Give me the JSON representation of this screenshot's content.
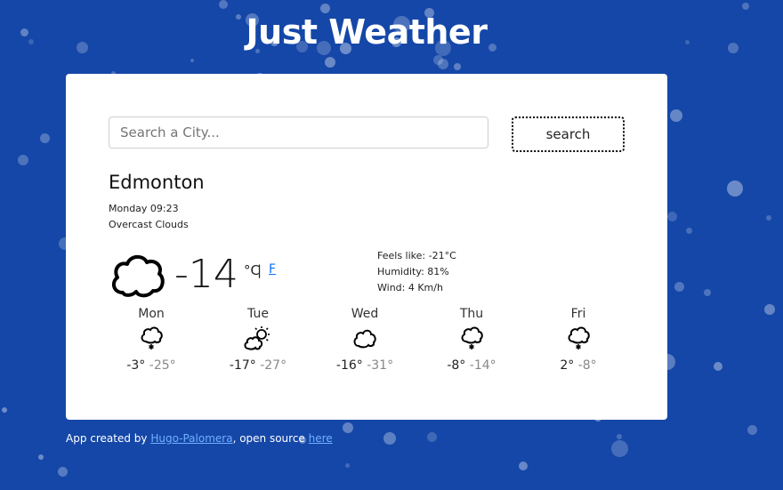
{
  "app": {
    "title": "Just Weather"
  },
  "search": {
    "placeholder": "Search a City...",
    "button_label": "search"
  },
  "current": {
    "city": "Edmonton",
    "datetime": "Monday 09:23",
    "description": "Overcast Clouds",
    "icon": "cloud-icon",
    "temperature": "-14",
    "unit_celsius": "°C",
    "unit_separator": "|",
    "unit_fahrenheit": "F",
    "feels_like": "Feels like: -21°C",
    "humidity": "Humidity: 81%",
    "wind": "Wind: 4 Km/h"
  },
  "forecast": [
    {
      "day": "Mon",
      "icon": "cloud-snow-icon",
      "max": "-3°",
      "min": "-25°"
    },
    {
      "day": "Tue",
      "icon": "sun-cloud-icon",
      "max": "-17°",
      "min": "-27°"
    },
    {
      "day": "Wed",
      "icon": "cloud-icon",
      "max": "-16°",
      "min": "-31°"
    },
    {
      "day": "Thu",
      "icon": "cloud-snow-icon",
      "max": "-8°",
      "min": "-14°"
    },
    {
      "day": "Fri",
      "icon": "cloud-snow-icon",
      "max": "2°",
      "min": "-8°"
    }
  ],
  "footer": {
    "prefix": "App created by ",
    "author": "Hugo-Palomera",
    "middle": ", open source ",
    "link": "here"
  },
  "colors": {
    "background": "#1547a8",
    "card": "#ffffff",
    "link": "#0d6efd"
  }
}
